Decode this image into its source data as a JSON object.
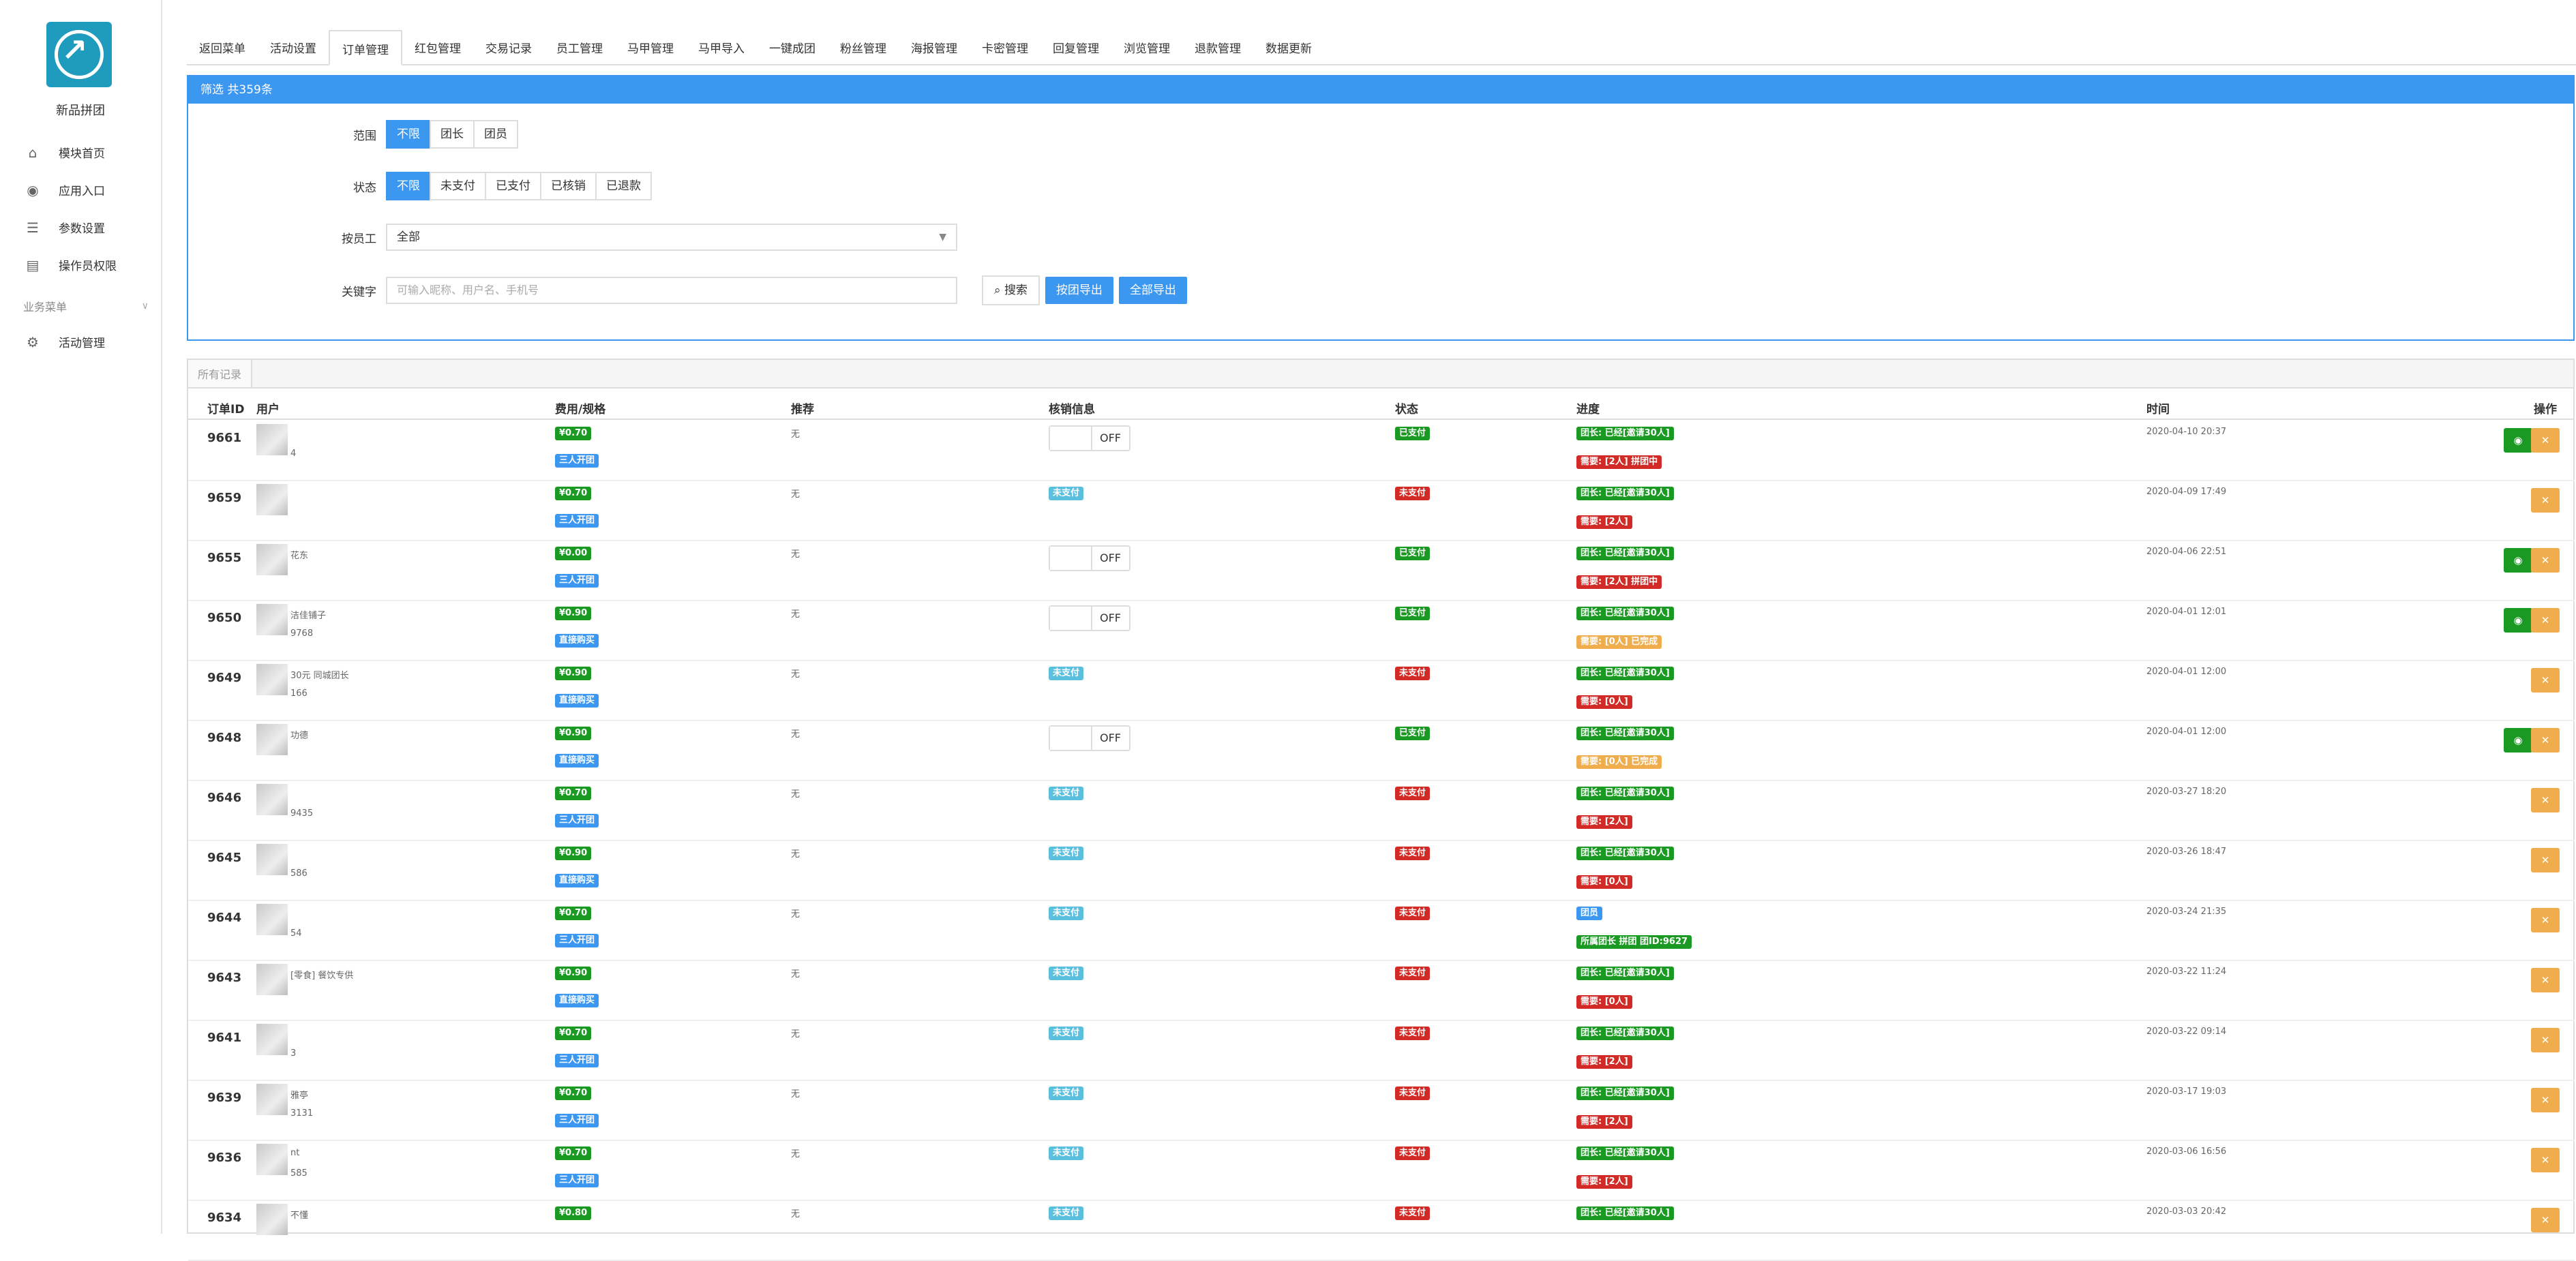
{
  "app": {
    "name": "新品拼团"
  },
  "sidebar": {
    "items": [
      {
        "label": "模块首页",
        "icon": "home-icon"
      },
      {
        "label": "应用入口",
        "icon": "chat-icon"
      },
      {
        "label": "参数设置",
        "icon": "list-icon"
      },
      {
        "label": "操作员权限",
        "icon": "document-icon"
      }
    ],
    "group": {
      "label": "业务菜单"
    },
    "group_items": [
      {
        "label": "活动管理",
        "icon": "gear-icon"
      }
    ]
  },
  "tabs": [
    "返回菜单",
    "活动设置",
    "订单管理",
    "红包管理",
    "交易记录",
    "员工管理",
    "马甲管理",
    "马甲导入",
    "一键成团",
    "粉丝管理",
    "海报管理",
    "卡密管理",
    "回复管理",
    "浏览管理",
    "退款管理",
    "数据更新"
  ],
  "active_tab": "订单管理",
  "filter": {
    "title": "筛选 共359条",
    "scope_label": "范围",
    "scope_options": [
      "不限",
      "团长",
      "团员"
    ],
    "status_label": "状态",
    "status_options": [
      "不限",
      "未支付",
      "已支付",
      "已核销",
      "已退款"
    ],
    "staff_label": "按员工",
    "staff_value": "全部",
    "keyword_label": "关键字",
    "keyword_placeholder": "可输入昵称、用户名、手机号",
    "search_label": "搜索",
    "export_group_label": "按团导出",
    "export_all_label": "全部导出"
  },
  "records": {
    "tab_label": "所有记录",
    "columns": {
      "id": "订单ID",
      "user": "用户",
      "fee": "费用/规格",
      "recommend": "推荐",
      "verify": "核销信息",
      "status": "状态",
      "progress": "进度",
      "time": "时间",
      "action": "操作"
    },
    "rows": [
      {
        "id": "9661",
        "uname": "",
        "usub": "4",
        "price": "¥0.70",
        "spec": "三人开团",
        "rec": "无",
        "verify": "OFF",
        "status": "已支付",
        "p1": "团长: 已经[邀请30人]",
        "p2": "需要: [2人] 拼团中",
        "time": "2020-04-10 20:37",
        "view": true
      },
      {
        "id": "9659",
        "uname": "",
        "usub": "",
        "price": "¥0.70",
        "spec": "三人开团",
        "rec": "无",
        "verify": "未支付",
        "status": "未支付",
        "p1": "团长: 已经[邀请30人]",
        "p2": "需要: [2人]",
        "time": "2020-04-09 17:49",
        "view": false
      },
      {
        "id": "9655",
        "uname": "花东",
        "usub": "",
        "price": "¥0.00",
        "spec": "三人开团",
        "rec": "无",
        "verify": "OFF",
        "status": "已支付",
        "p1": "团长: 已经[邀请30人]",
        "p2": "需要: [2人] 拼团中",
        "time": "2020-04-06 22:51",
        "view": true
      },
      {
        "id": "9650",
        "uname": "洁佳铺子",
        "usub": "9768",
        "price": "¥0.90",
        "spec": "直接购买",
        "rec": "无",
        "verify": "OFF",
        "status": "已支付",
        "p1": "团长: 已经[邀请30人]",
        "p2": "需要: [0人] 已完成",
        "time": "2020-04-01 12:01",
        "view": true
      },
      {
        "id": "9649",
        "uname": "30元 同城团长",
        "usub": "166",
        "price": "¥0.90",
        "spec": "直接购买",
        "rec": "无",
        "verify": "未支付",
        "status": "未支付",
        "p1": "团长: 已经[邀请30人]",
        "p2": "需要: [0人]",
        "time": "2020-04-01 12:00",
        "view": false
      },
      {
        "id": "9648",
        "uname": "功德",
        "usub": "",
        "price": "¥0.90",
        "spec": "直接购买",
        "rec": "无",
        "verify": "OFF",
        "status": "已支付",
        "p1": "团长: 已经[邀请30人]",
        "p2": "需要: [0人] 已完成",
        "time": "2020-04-01 12:00",
        "view": true
      },
      {
        "id": "9646",
        "uname": "",
        "usub": "9435",
        "price": "¥0.70",
        "spec": "三人开团",
        "rec": "无",
        "verify": "未支付",
        "status": "未支付",
        "p1": "团长: 已经[邀请30人]",
        "p2": "需要: [2人]",
        "time": "2020-03-27 18:20",
        "view": false
      },
      {
        "id": "9645",
        "uname": "",
        "usub": "586",
        "price": "¥0.90",
        "spec": "直接购买",
        "rec": "无",
        "verify": "未支付",
        "status": "未支付",
        "p1": "团长: 已经[邀请30人]",
        "p2": "需要: [0人]",
        "time": "2020-03-26 18:47",
        "view": false
      },
      {
        "id": "9644",
        "uname": "",
        "usub": "54",
        "price": "¥0.70",
        "spec": "三人开团",
        "rec": "无",
        "verify": "未支付",
        "status": "未支付",
        "p1": "团员",
        "p2": "所属团长 拼团 团ID:9627",
        "time": "2020-03-24 21:35",
        "view": false
      },
      {
        "id": "9643",
        "uname": "[零食] 餐饮专供",
        "usub": "",
        "price": "¥0.90",
        "spec": "直接购买",
        "rec": "无",
        "verify": "未支付",
        "status": "未支付",
        "p1": "团长: 已经[邀请30人]",
        "p2": "需要: [0人]",
        "time": "2020-03-22 11:24",
        "view": false
      },
      {
        "id": "9641",
        "uname": "",
        "usub": "3",
        "price": "¥0.70",
        "spec": "三人开团",
        "rec": "无",
        "verify": "未支付",
        "status": "未支付",
        "p1": "团长: 已经[邀请30人]",
        "p2": "需要: [2人]",
        "time": "2020-03-22 09:14",
        "view": false
      },
      {
        "id": "9639",
        "uname": "雅亭",
        "usub": "3131",
        "price": "¥0.70",
        "spec": "三人开团",
        "rec": "无",
        "verify": "未支付",
        "status": "未支付",
        "p1": "团长: 已经[邀请30人]",
        "p2": "需要: [2人]",
        "time": "2020-03-17 19:03",
        "view": false
      },
      {
        "id": "9636",
        "uname": "nt",
        "usub": "585",
        "price": "¥0.70",
        "spec": "三人开团",
        "rec": "无",
        "verify": "未支付",
        "status": "未支付",
        "p1": "团长: 已经[邀请30人]",
        "p2": "需要: [2人]",
        "time": "2020-03-06 16:56",
        "view": false
      },
      {
        "id": "9634",
        "uname": "不懂",
        "usub": "",
        "price": "¥0.80",
        "spec": "",
        "rec": "无",
        "verify": "未支付",
        "status": "未支付",
        "p1": "团长: 已经[邀请30人]",
        "p2": "",
        "time": "2020-03-03 20:42",
        "view": false
      }
    ]
  },
  "colors": {
    "primary": "#3c97f0",
    "success": "#1a9a22",
    "danger": "#d22a26",
    "warning": "#f0ad4e",
    "info": "#5bc0de"
  }
}
